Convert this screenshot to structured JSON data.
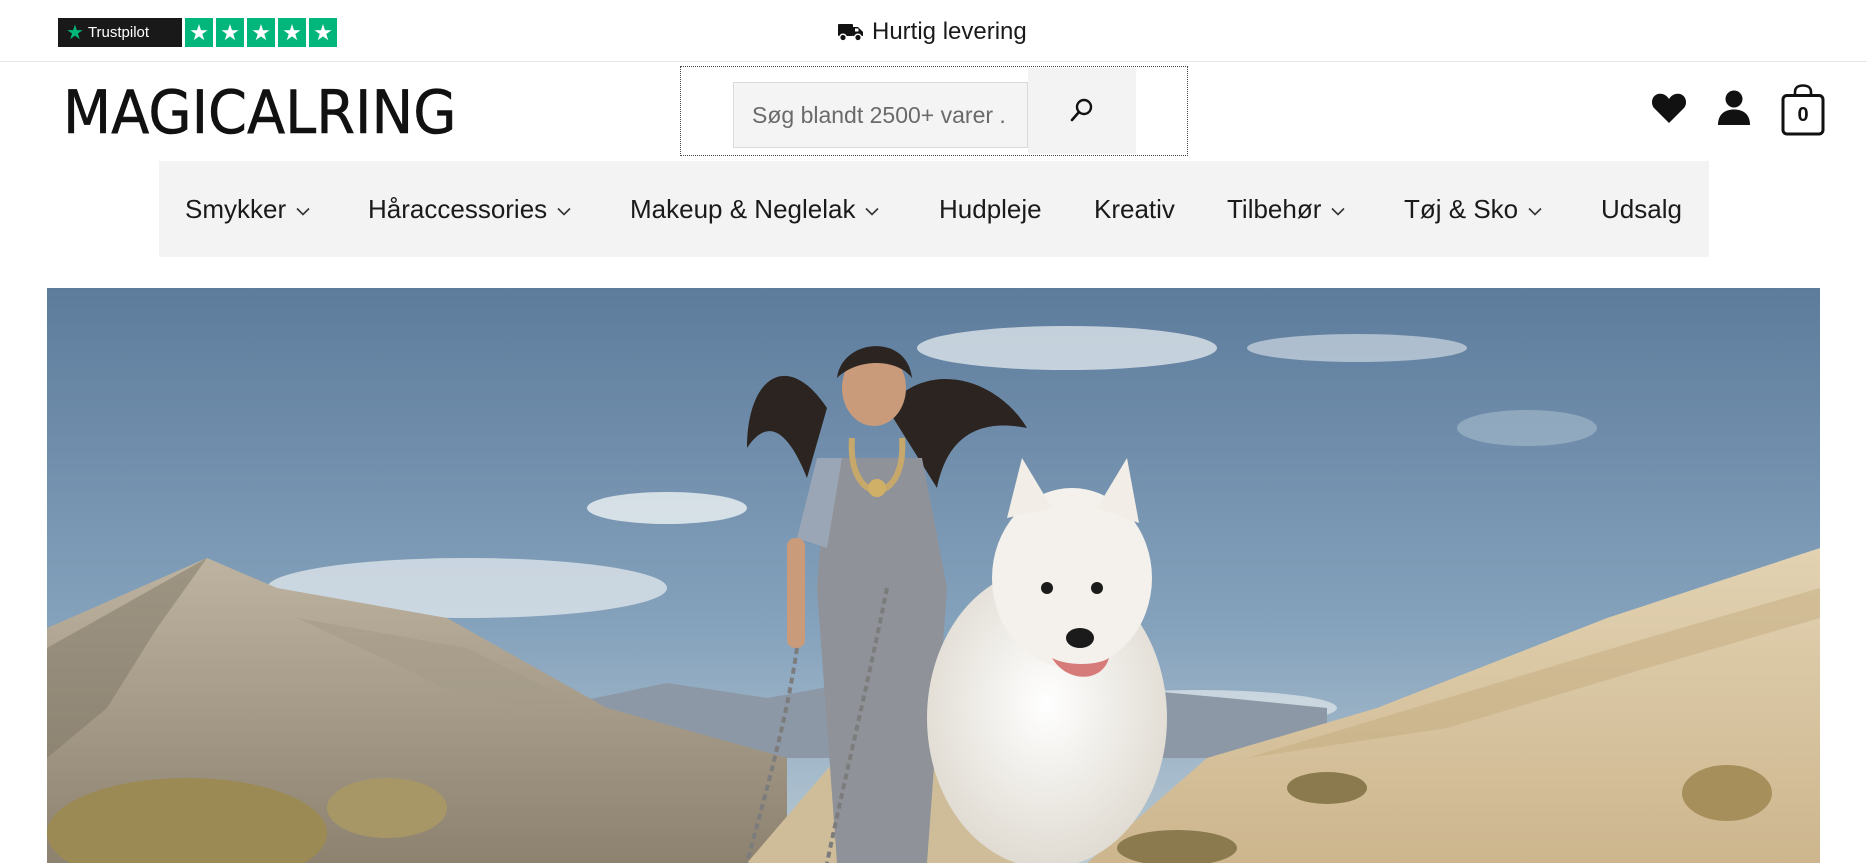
{
  "topbar": {
    "trustpilot": {
      "brand": "Trustpilot",
      "stars": 5,
      "brand_color": "#00b67a"
    },
    "delivery_text": "Hurtig levering"
  },
  "header": {
    "logo_text": "MAGICALRING",
    "search": {
      "placeholder": "Søg blandt 2500+ varer ."
    },
    "icons": [
      "heart-icon",
      "user-icon",
      "shopping-bag-icon"
    ],
    "cart_count": "0"
  },
  "nav": {
    "items": [
      {
        "label": "Smykker",
        "dropdown": true
      },
      {
        "label": "Håraccessories",
        "dropdown": true
      },
      {
        "label": "Makeup & Neglelak",
        "dropdown": true
      },
      {
        "label": "Hudpleje",
        "dropdown": false
      },
      {
        "label": "Kreativ",
        "dropdown": false
      },
      {
        "label": "Tilbehør",
        "dropdown": true
      },
      {
        "label": "Tøj & Sko",
        "dropdown": true
      },
      {
        "label": "Udsalg",
        "dropdown": false
      }
    ]
  },
  "hero": {
    "image": "girl-with-white-dog-in-desert-dunes",
    "colors": {
      "sky": "#6f8fae",
      "sand": "#d9c7a4"
    }
  }
}
